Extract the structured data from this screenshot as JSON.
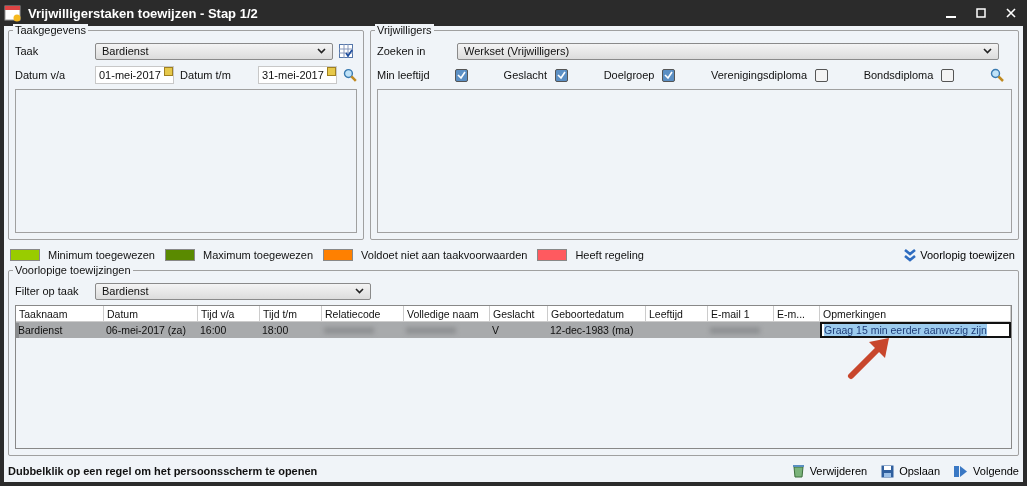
{
  "window": {
    "title": "Vrijwilligerstaken toewijzen - Stap 1/2"
  },
  "task_panel": {
    "title": "Taakgegevens",
    "task_label": "Taak",
    "task_value": "Bardienst",
    "from_label": "Datum v/a",
    "from_value": "01-mei-2017",
    "to_label": "Datum t/m",
    "to_value": "31-mei-2017"
  },
  "volunteer_panel": {
    "title": "Vrijwilligers",
    "search_label": "Zoeken in",
    "search_value": "Werkset (Vrijwilligers)",
    "filters": [
      {
        "label": "Min leeftijd",
        "checked": true
      },
      {
        "label": "Geslacht",
        "checked": true
      },
      {
        "label": "Doelgroep",
        "checked": true
      },
      {
        "label": "Verenigingsdiploma",
        "checked": false
      },
      {
        "label": "Bondsdiploma",
        "checked": false
      }
    ]
  },
  "legend": [
    {
      "label": "Minimum toegewezen",
      "color": "#99cc00"
    },
    {
      "label": "Maximum toegewezen",
      "color": "#5a8a00"
    },
    {
      "label": "Voldoet niet aan taakvoorwaarden",
      "color": "#ff8000"
    },
    {
      "label": "Heeft regeling",
      "color": "#ff5a5f"
    }
  ],
  "assign_button": "Voorlopig toewijzen",
  "assignments": {
    "title": "Voorlopige toewijzingen",
    "filter_label": "Filter op taak",
    "filter_value": "Bardienst",
    "columns": [
      "Taaknaam",
      "Datum",
      "Tijd v/a",
      "Tijd t/m",
      "Relatiecode",
      "Volledige naam",
      "Geslacht",
      "Geboortedatum",
      "Leeftijd",
      "E-mail 1",
      "E-m...",
      "Opmerkingen"
    ],
    "rows": [
      {
        "selected": true,
        "cells": [
          {
            "kind": "text",
            "text": "Bardienst"
          },
          {
            "kind": "text",
            "text": "06-mei-2017 (za)"
          },
          {
            "kind": "text",
            "text": "16:00"
          },
          {
            "kind": "text",
            "text": "18:00"
          },
          {
            "kind": "redacted"
          },
          {
            "kind": "redacted"
          },
          {
            "kind": "text",
            "text": "V"
          },
          {
            "kind": "text",
            "text": "12-dec-1983 (ma)"
          },
          {
            "kind": "empty"
          },
          {
            "kind": "redacted"
          },
          {
            "kind": "empty"
          },
          {
            "kind": "editing",
            "text": "Graag 15 min eerder aanwezig zijn"
          }
        ]
      }
    ]
  },
  "status_bar": {
    "hint": "Dubbelklik op een regel om het persoonsscherm te openen",
    "actions": [
      {
        "kind": "delete",
        "label": "Verwijderen"
      },
      {
        "kind": "save",
        "label": "Opslaan"
      },
      {
        "kind": "next",
        "label": "Volgende"
      }
    ]
  }
}
